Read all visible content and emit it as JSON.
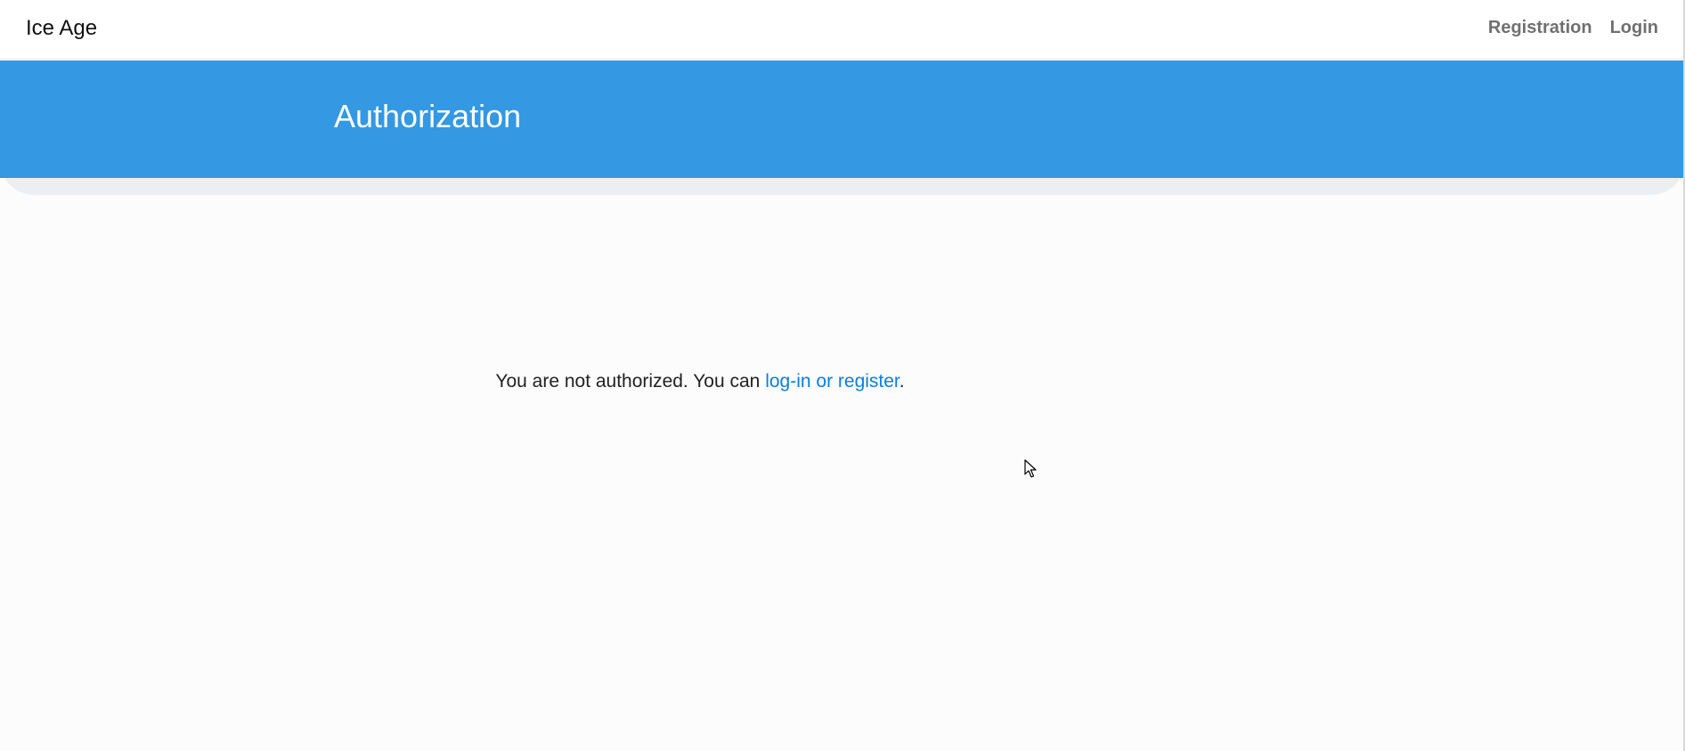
{
  "navbar": {
    "brand": "Ice Age",
    "links": [
      {
        "label": "Registration"
      },
      {
        "label": "Login"
      }
    ]
  },
  "hero": {
    "title": "Authorization",
    "color": "#3498e2"
  },
  "main": {
    "message_prefix": "You are not authorized. You can ",
    "link_text": "log-in or register",
    "message_suffix": "."
  },
  "icons": {
    "cursor": "mouse-pointer-icon"
  }
}
